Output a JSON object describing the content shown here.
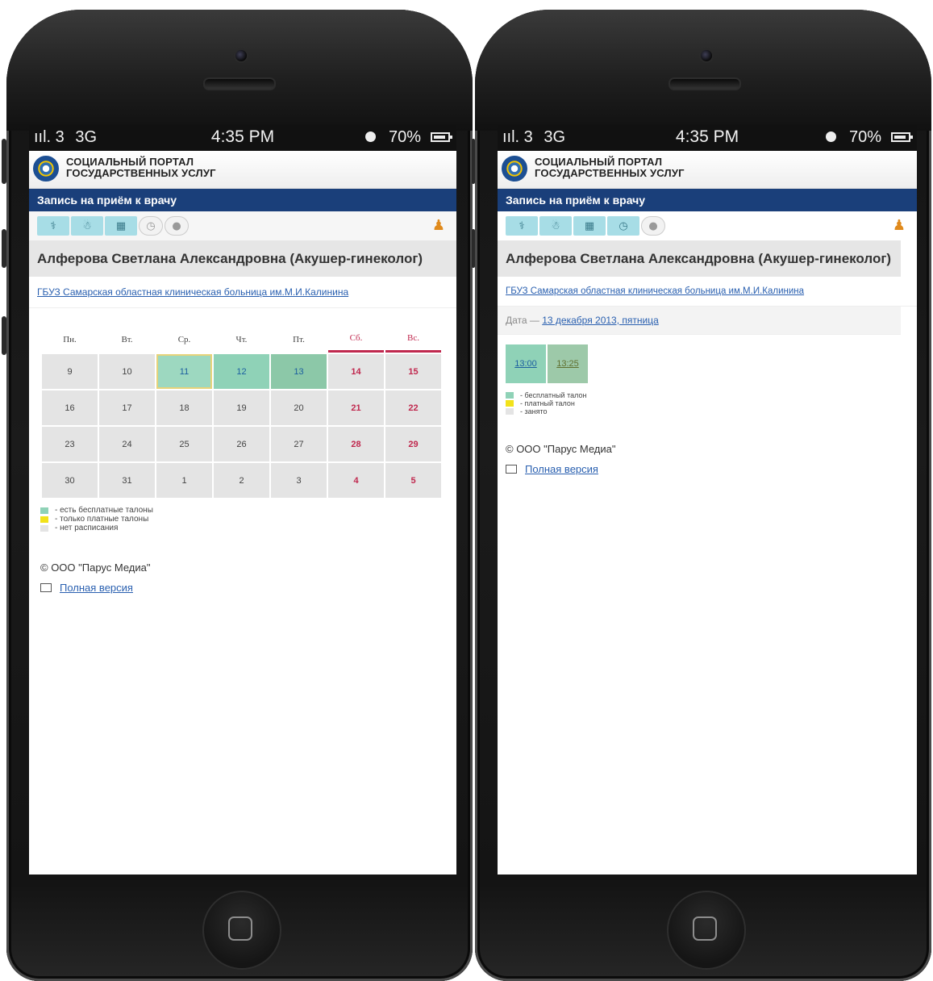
{
  "phones": [
    {
      "status": {
        "signal": "ııl. 3",
        "network": "3G",
        "time": "4:35 PM",
        "battery": "70%"
      },
      "portal_title_line1": "Социальный портал",
      "portal_title_line2": "государственных услуг",
      "nav_title": "Запись на приём к врачу",
      "doctor_name": "Алферова Светлана Александровна (Акушер-гинеколог)",
      "org_link": "ГБУЗ Самарская областная клиническая больница им.М.И.Калинина",
      "calendar": {
        "weekdays": [
          "Пн.",
          "Вт.",
          "Ср.",
          "Чт.",
          "Пт.",
          "Сб.",
          "Вс."
        ],
        "weeks": [
          [
            "9",
            "10",
            "11",
            "12",
            "13",
            "14",
            "15"
          ],
          [
            "16",
            "17",
            "18",
            "19",
            "20",
            "21",
            "22"
          ],
          [
            "23",
            "24",
            "25",
            "26",
            "27",
            "28",
            "29"
          ],
          [
            "30",
            "31",
            "1",
            "2",
            "3",
            "4",
            "5"
          ]
        ]
      },
      "legend": [
        {
          "label": "- есть бесплатные талоны",
          "color": "#8fd2b7"
        },
        {
          "label": "- только платные талоны",
          "color": "#f2e21a"
        },
        {
          "label": "- нет расписания",
          "color": "#e4e4e4"
        }
      ],
      "copyright": "© ООО \"Парус Медиа\"",
      "full_version": "Полная версия"
    },
    {
      "status": {
        "signal": "ııl. 3",
        "network": "3G",
        "time": "4:35 PM",
        "battery": "70%"
      },
      "portal_title_line1": "Социальный портал",
      "portal_title_line2": "государственных услуг",
      "nav_title": "Запись на приём к врачу",
      "doctor_name": "Алферова Светлана Александровна (Акушер-гинеколог)",
      "org_link": "ГБУЗ Самарская областная клиническая больница им.М.И.Калинина",
      "date_label": "Дата —",
      "date_value": "13 декабря 2013, пятница",
      "slots": [
        "13:00",
        "13:25"
      ],
      "legend": [
        {
          "label": "- бесплатный талон",
          "color": "#8fd2b7"
        },
        {
          "label": "- платный талон",
          "color": "#f2e21a"
        },
        {
          "label": "- занято",
          "color": "#e4e4e4"
        }
      ],
      "copyright": "© ООО \"Парус Медиа\"",
      "full_version": "Полная версия"
    }
  ]
}
